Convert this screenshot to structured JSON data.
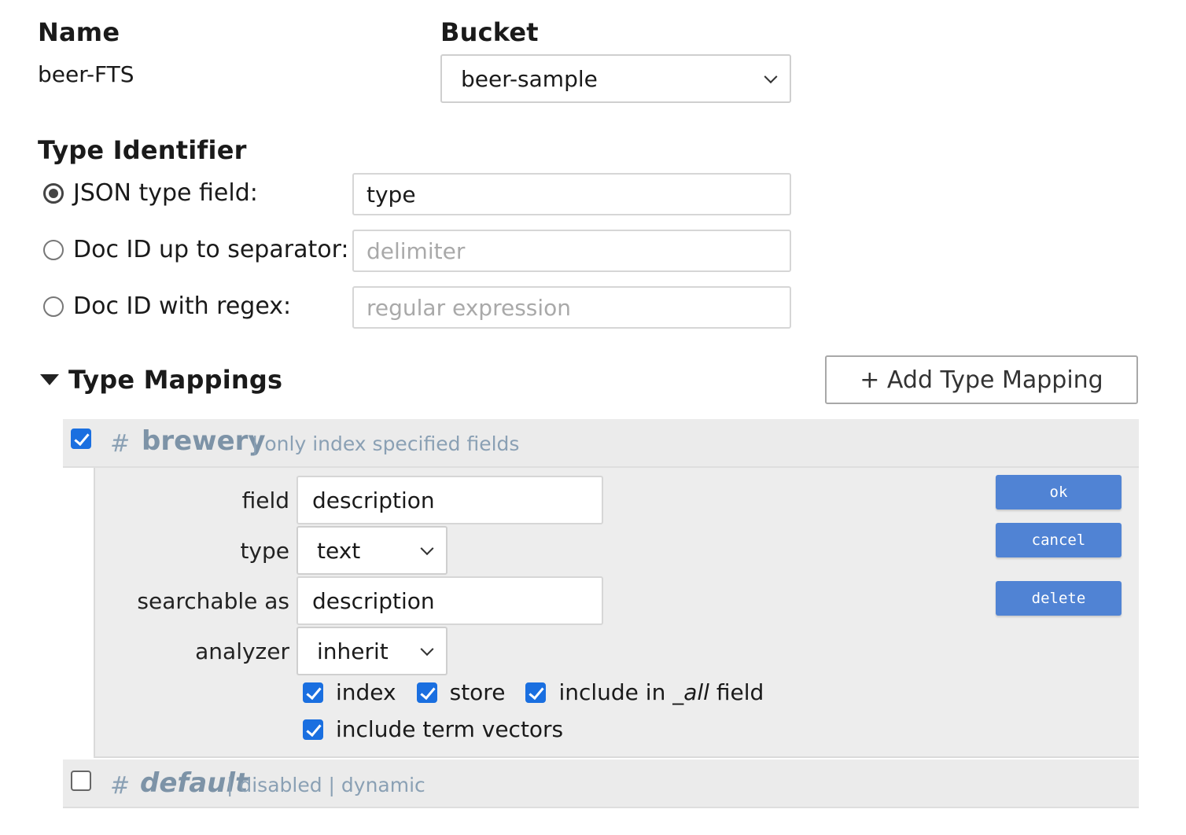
{
  "form": {
    "name_label": "Name",
    "name_value": "beer-FTS",
    "bucket_label": "Bucket",
    "bucket_value": "beer-sample"
  },
  "type_identifier": {
    "heading": "Type Identifier",
    "options": [
      {
        "label": "JSON type field:",
        "checked": true,
        "value": "type",
        "placeholder": ""
      },
      {
        "label": "Doc ID up to separator:",
        "checked": false,
        "value": "",
        "placeholder": "delimiter"
      },
      {
        "label": "Doc ID with regex:",
        "checked": false,
        "value": "",
        "placeholder": "regular expression"
      }
    ]
  },
  "type_mappings": {
    "heading": "Type Mappings",
    "add_button": "+ Add Type Mapping",
    "mappings": [
      {
        "checked": true,
        "hash": "#",
        "name": "brewery",
        "meta": "| only index specified fields"
      },
      {
        "checked": false,
        "hash": "#",
        "name": "default",
        "meta": "| disabled | dynamic"
      }
    ]
  },
  "field_editor": {
    "field_label": "field",
    "field_value": "description",
    "type_label": "type",
    "type_value": "text",
    "searchable_label": "searchable as",
    "searchable_value": "description",
    "analyzer_label": "analyzer",
    "analyzer_value": "inherit",
    "options": {
      "index": "index",
      "store": "store",
      "include_prefix": "include in ",
      "include_all": "_all",
      "include_suffix": " field",
      "term_vectors": "include term vectors"
    },
    "buttons": {
      "ok": "ok",
      "cancel": "cancel",
      "delete": "delete"
    }
  },
  "colors": {
    "accent_blue": "#5083d4",
    "checkbox_blue": "#1a6fe0",
    "mapping_text": "#7d93a7"
  }
}
